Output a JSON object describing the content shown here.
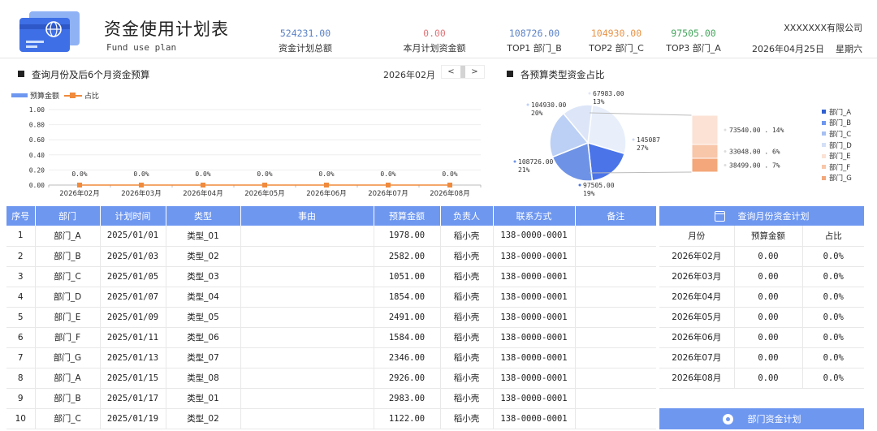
{
  "header": {
    "title": "资金使用计划表",
    "subtitle": "Fund use plan",
    "company": "XXXXXXX有限公司",
    "date": "2026年04月25日",
    "weekday": "星期六",
    "stats": [
      {
        "value": "524231.00",
        "label": "资金计划总额",
        "color": "#5b82c6"
      },
      {
        "value": "0.00",
        "label": "本月计划资金额",
        "color": "#e0757a"
      },
      {
        "value": "108726.00",
        "label": "TOP1  部门_B",
        "color": "#5b82c6"
      },
      {
        "value": "104930.00",
        "label": "TOP2  部门_C",
        "color": "#e89447"
      },
      {
        "value": "97505.00",
        "label": "TOP3  部门_A",
        "color": "#43a55b"
      }
    ]
  },
  "left_section": {
    "title": "查询月份及后6个月资金预算",
    "month": "2026年02月",
    "prev": "<",
    "next": ">",
    "legend_budget": "预算金额",
    "legend_ratio": "占比"
  },
  "right_section": {
    "title": "各预算类型资金占比"
  },
  "chart_data": [
    {
      "type": "bar",
      "title": "",
      "categories": [
        "2026年02月",
        "2026年03月",
        "2026年04月",
        "2026年05月",
        "2026年06月",
        "2026年07月",
        "2026年08月"
      ],
      "series": [
        {
          "name": "预算金额",
          "values": [
            0,
            0,
            0,
            0,
            0,
            0,
            0
          ]
        },
        {
          "name": "占比",
          "values": [
            0,
            0,
            0,
            0,
            0,
            0,
            0
          ],
          "labels": [
            "0.0%",
            "0.0%",
            "0.0%",
            "0.0%",
            "0.0%",
            "0.0%",
            "0.0%"
          ]
        }
      ],
      "yticks": [
        "1.00",
        "0.80",
        "0.60",
        "0.40",
        "0.20",
        "0.00"
      ],
      "ylim": [
        0,
        1
      ],
      "colors": {
        "budget": "#6e97f0",
        "ratio": "#f08a3c"
      }
    },
    {
      "type": "pie",
      "slices": [
        {
          "name": "部门_A",
          "value": 145087,
          "label": "145087",
          "pct": "27%",
          "color": "#e8effb"
        },
        {
          "name": "部门_B",
          "value": 97505,
          "label": "97505.00",
          "pct": "19%",
          "color": "#4a74e8"
        },
        {
          "name": "部门_C",
          "value": 108726,
          "label": "108726.00",
          "pct": "21%",
          "color": "#6e93e6"
        },
        {
          "name": "部门_D",
          "value": 104930,
          "label": "104930.00",
          "pct": "20%",
          "color": "#bcd0f5"
        },
        {
          "name": "部门_E",
          "value": 67983,
          "label": "67983.00",
          "pct": "13%",
          "color": "#dde6f8"
        }
      ],
      "stack": [
        {
          "name": "部门_E",
          "label": "73540.00",
          "pct": "14%",
          "color": "#fbe2d4"
        },
        {
          "name": "部门_F",
          "label": "33048.00",
          "pct": "6%",
          "color": "#f8c6a9"
        },
        {
          "name": "部门_G",
          "label": "38499.00",
          "pct": "7%",
          "color": "#f3a77a"
        }
      ],
      "legend": [
        {
          "name": "部门_A",
          "color": "#2f5fd0"
        },
        {
          "name": "部门_B",
          "color": "#6e97f0"
        },
        {
          "name": "部门_C",
          "color": "#a7c0f2"
        },
        {
          "name": "部门_D",
          "color": "#d4e0f7"
        },
        {
          "name": "部门_E",
          "color": "#fbe2d4"
        },
        {
          "name": "部门_F",
          "color": "#f8c6a9"
        },
        {
          "name": "部门_G",
          "color": "#f3a77a"
        }
      ]
    }
  ],
  "table": {
    "headers": [
      "序号",
      "部门",
      "计划时间",
      "类型",
      "事由",
      "预算金额",
      "负责人",
      "联系方式",
      "备注"
    ],
    "rows": [
      [
        "1",
        "部门_A",
        "2025/01/01",
        "类型_01",
        "",
        "1978.00",
        "稻小壳",
        "138-0000-0001",
        ""
      ],
      [
        "2",
        "部门_B",
        "2025/01/03",
        "类型_02",
        "",
        "2582.00",
        "稻小壳",
        "138-0000-0001",
        ""
      ],
      [
        "3",
        "部门_C",
        "2025/01/05",
        "类型_03",
        "",
        "1051.00",
        "稻小壳",
        "138-0000-0001",
        ""
      ],
      [
        "4",
        "部门_D",
        "2025/01/07",
        "类型_04",
        "",
        "1854.00",
        "稻小壳",
        "138-0000-0001",
        ""
      ],
      [
        "5",
        "部门_E",
        "2025/01/09",
        "类型_05",
        "",
        "2491.00",
        "稻小壳",
        "138-0000-0001",
        ""
      ],
      [
        "6",
        "部门_F",
        "2025/01/11",
        "类型_06",
        "",
        "1584.00",
        "稻小壳",
        "138-0000-0001",
        ""
      ],
      [
        "7",
        "部门_G",
        "2025/01/13",
        "类型_07",
        "",
        "2346.00",
        "稻小壳",
        "138-0000-0001",
        ""
      ],
      [
        "8",
        "部门_A",
        "2025/01/15",
        "类型_08",
        "",
        "2926.00",
        "稻小壳",
        "138-0000-0001",
        ""
      ],
      [
        "9",
        "部门_B",
        "2025/01/17",
        "类型_01",
        "",
        "2983.00",
        "稻小壳",
        "138-0000-0001",
        ""
      ],
      [
        "10",
        "部门_C",
        "2025/01/19",
        "类型_02",
        "",
        "1122.00",
        "稻小壳",
        "138-0000-0001",
        ""
      ]
    ]
  },
  "side": {
    "title": "查询月份资金计划",
    "headers": [
      "月份",
      "预算金额",
      "占比"
    ],
    "rows": [
      [
        "2026年02月",
        "0.00",
        "0.0%"
      ],
      [
        "2026年03月",
        "0.00",
        "0.0%"
      ],
      [
        "2026年04月",
        "0.00",
        "0.0%"
      ],
      [
        "2026年05月",
        "0.00",
        "0.0%"
      ],
      [
        "2026年06月",
        "0.00",
        "0.0%"
      ],
      [
        "2026年07月",
        "0.00",
        "0.0%"
      ],
      [
        "2026年08月",
        "0.00",
        "0.0%"
      ]
    ],
    "button": "部门资金计划"
  }
}
